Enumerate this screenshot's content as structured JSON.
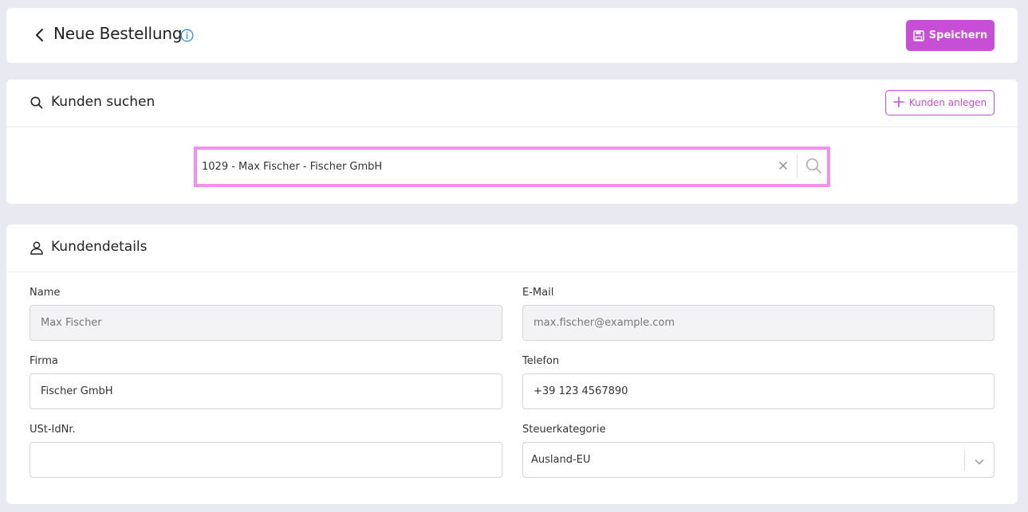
{
  "header": {
    "title": "Neue Bestellung",
    "save_label": "Speichern"
  },
  "search_section": {
    "title": "Kunden suchen",
    "add_label": "Kunden anlegen",
    "search_value": "1029 - Max Fischer - Fischer GmbH"
  },
  "details_section": {
    "title": "Kundendetails",
    "name": {
      "label": "Name",
      "value": "Max Fischer"
    },
    "email": {
      "label": "E-Mail",
      "value": "max.fischer@example.com"
    },
    "company": {
      "label": "Firma",
      "value": "Fischer GmbH"
    },
    "phone": {
      "label": "Telefon",
      "value": "+39 123 4567890"
    },
    "vat": {
      "label": "USt-IdNr.",
      "value": ""
    },
    "tax_category": {
      "label": "Steuerkategorie",
      "value": "Ausland-EU"
    }
  },
  "colors": {
    "accent": "#c64fd6",
    "highlight": "#f48ff0",
    "info": "#2f8fdc"
  },
  "icons": [
    "chevron-left-icon",
    "info-icon",
    "save-icon",
    "search-icon",
    "plus-icon",
    "close-icon",
    "user-icon",
    "chevron-down-icon"
  ]
}
